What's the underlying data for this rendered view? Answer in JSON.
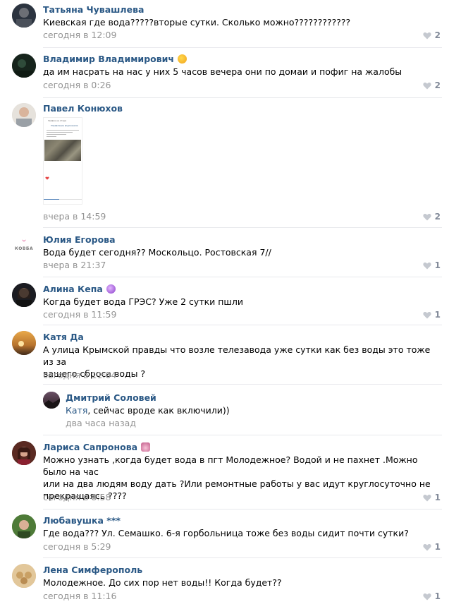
{
  "comments": [
    {
      "author": "Татьяна Чувашлева",
      "text": "Киевская где вода?????вторые сутки. Сколько можно????????????",
      "date": "сегодня в 12:09",
      "likes": "2",
      "avatar_color": "#3b4656"
    },
    {
      "author": "Владимир Владимирович",
      "text": "да им насрать на нас у них 5 часов вечера они по домаи и пофиг на жалобы",
      "date": "сегодня в 0:26",
      "likes": "2",
      "avatar_color": "#1f2d25"
    },
    {
      "author": "Павел Конюхов",
      "text": "",
      "date": "вчера в 14:59",
      "likes": "2",
      "avatar_color": "#c9c4bd"
    },
    {
      "author": "Юлия Егорова",
      "text": "Вода будет сегодня?? Москольцо. Ростовская 7//",
      "date": "вчера в 21:37",
      "likes": "1",
      "avatar_color": "#ffffff"
    },
    {
      "author": "Алина Кепа",
      "text": "Когда будет вода ГРЭС? Уже 2 сутки пшли",
      "date": "сегодня в 11:59",
      "likes": "1",
      "avatar_color": "#22232a"
    },
    {
      "author": "Катя Да",
      "text_line1": "А улица Крымской правды что возле телезавода уже сутки как без воды это тоже из за",
      "text_line2": "вашего сброса воды ?",
      "date": "сегодня в 11:04",
      "likes": "",
      "avatar_color": "#b37a36"
    },
    {
      "author": "Лариса Сапронова",
      "text_line1": "Можно узнать ,когда будет вода в пгт Молодежное? Водой и не пахнет .Можно было на час",
      "text_line2": "или на два людям воду дать ?Или ремонтные работы у вас идут круглосуточно не",
      "text_line3": "прекращаясь ????",
      "date": "сегодня в 8:58",
      "likes": "1",
      "avatar_color": "#6a3b2e"
    },
    {
      "author": "Любавушка ***",
      "text": "Где вода??? Ул. Семашко. 6-я горбольница тоже без воды сидит почти сутки?",
      "date": "сегодня в 5:29",
      "likes": "1",
      "avatar_color": "#4f7a3a"
    },
    {
      "author": "Лена Симферополь",
      "text": "Молодежное. До сих пор нет воды!! Когда будет??",
      "date": "сегодня в 11:16",
      "likes": "1",
      "avatar_color": "#d8b98a"
    }
  ],
  "reply": {
    "author": "Дмитрий Соловей",
    "mention": "Катя",
    "text": ", сейчас вроде как включили))",
    "date": "два часа назад"
  },
  "attachment": {
    "header": "Заявка на отзыв",
    "org": "Управление водоканала",
    "progress": 0.4
  },
  "logo_text": "КОВБА"
}
